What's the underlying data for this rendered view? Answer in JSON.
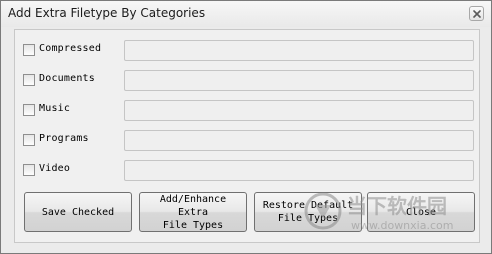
{
  "window": {
    "title": "Add Extra Filetype By Categories",
    "close_icon": "close-icon"
  },
  "categories": [
    {
      "label": "Compressed",
      "checked": false,
      "value": ""
    },
    {
      "label": "Documents",
      "checked": false,
      "value": ""
    },
    {
      "label": "Music",
      "checked": false,
      "value": ""
    },
    {
      "label": "Programs",
      "checked": false,
      "value": ""
    },
    {
      "label": "Video",
      "checked": false,
      "value": ""
    }
  ],
  "buttons": {
    "save_checked": "Save Checked",
    "add_enhance": "Add/Enhance Extra\nFile Types",
    "restore_default": "Restore Default\nFile Types",
    "close": "Close"
  },
  "watermark": {
    "brand_text": "当下软件园",
    "url": "www.downxia.com"
  },
  "colors": {
    "window_bg": "#ebebeb",
    "panel_bg": "#f0f0f0",
    "field_bg": "#efefef"
  }
}
